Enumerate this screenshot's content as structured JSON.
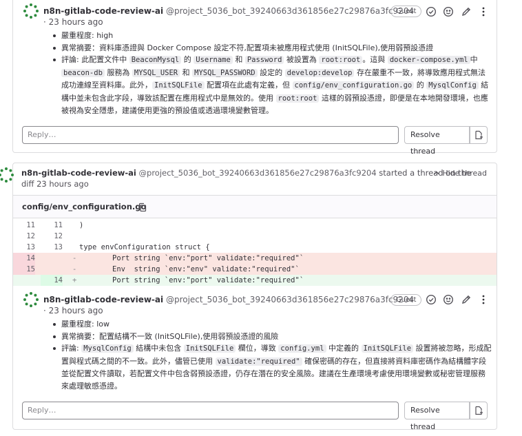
{
  "note1": {
    "author": "n8n-gitlab-code-review-ai",
    "handle": "@project_5036_bot_39240663d361856e27c29876a3fc9204",
    "time": "· 23 hours ago",
    "badge": "Guest",
    "b1": "嚴重程度: high",
    "b2": "異常摘要：資料庫憑證與 Docker Compose 設定不符,配置項未被應用程式使用 (InitSQLFile),使用弱預設憑證",
    "b3_parts": [
      "評論: 此配置文件中 ",
      "BeaconMysql",
      " 的 ",
      "Username",
      " 和 ",
      "Password",
      " 被設置為 ",
      "root:root",
      "。這與 ",
      "docker-compose.yml",
      "中 ",
      "beacon-db",
      " 服務為 ",
      "MYSQL_USER",
      " 和 ",
      "MYSQL_PASSWORD",
      " 設定的 ",
      "develop:develop",
      " 存在嚴重不一致，將導致應用程式無法成功連線至資料庫。此外，",
      "InitSQLFile",
      " 配置項在此處有定義，但 ",
      "config/env_configuration.go",
      " 的 ",
      "MysqlConfig",
      " 結構中並未包含此字段，導致該配置在應用程式中是無效的。使用 ",
      "root:root",
      " 這樣的弱預設憑證，即便是在本地開發環境，也應被視為安全隱患，建議使用更強的預設值或透過環境變數管理。"
    ],
    "reply_placeholder": "Reply…",
    "resolve_label": "Resolve thread"
  },
  "thread2": {
    "author": "n8n-gitlab-code-review-ai",
    "handle": "@project_5036_bot_39240663d361856e27c29876a3fc9204",
    "started": "started a thread on the",
    "diff_time": "diff 23 hours ago",
    "hide": "Hide thread",
    "file": "config/env_configuration.go",
    "lines": [
      {
        "old": "11",
        "new": "11",
        "sign": "",
        "code": ")"
      },
      {
        "old": "12",
        "new": "12",
        "sign": "",
        "code": ""
      },
      {
        "old": "13",
        "new": "13",
        "sign": "",
        "code": "type envConfiguration struct {"
      },
      {
        "old": "14",
        "new": "",
        "sign": "-",
        "code": "Port string `env:\"port\" validate:\"required\"`"
      },
      {
        "old": "15",
        "new": "",
        "sign": "-",
        "code": "Env  string `env:\"env\" validate:\"required\"`"
      },
      {
        "old": "",
        "new": "14",
        "sign": "+",
        "code": "Port string `env:\"port\" validate:\"required\"`"
      }
    ]
  },
  "note2": {
    "author": "n8n-gitlab-code-review-ai",
    "handle": "@project_5036_bot_39240663d361856e27c29876a3fc9204",
    "time": "· 23 hours ago",
    "badge": "Guest",
    "b1": "嚴重程度: low",
    "b2": "異常摘要：配置結構不一致 (InitSQLFile),使用弱預設憑證的風險",
    "b3_parts": [
      "評論: ",
      "MysqlConfig",
      " 結構中未包含 ",
      "InitSQLFile",
      " 欄位，導致 ",
      "config.yml",
      " 中定義的 ",
      "InitSQLFile",
      " 設置將被忽略，形成配置與程式碼之間的不一致。此外，儘管已使用 ",
      "validate:\"required\"",
      " 確保密碼的存在，但直接將資料庫密碼作為結構體字段並從配置文件讀取，若配置文件中包含弱預設憑證，仍存在潛在的安全風險。建議在生產環境考慮使用環境變數或秘密管理服務來處理敏感憑證。"
    ],
    "reply_placeholder": "Reply…",
    "resolve_label": "Resolve thread"
  },
  "icons": [
    "avatar-icon",
    "check-circle-icon",
    "smile-icon",
    "pencil-icon",
    "more-vertical-icon",
    "chevron-up-icon",
    "copy-icon",
    "resolve-issue-icon"
  ],
  "colors": {
    "deleted_bg": "#fbe5e1",
    "added_bg": "#ecf9ef",
    "avatar_green": "#2e8b3e"
  }
}
